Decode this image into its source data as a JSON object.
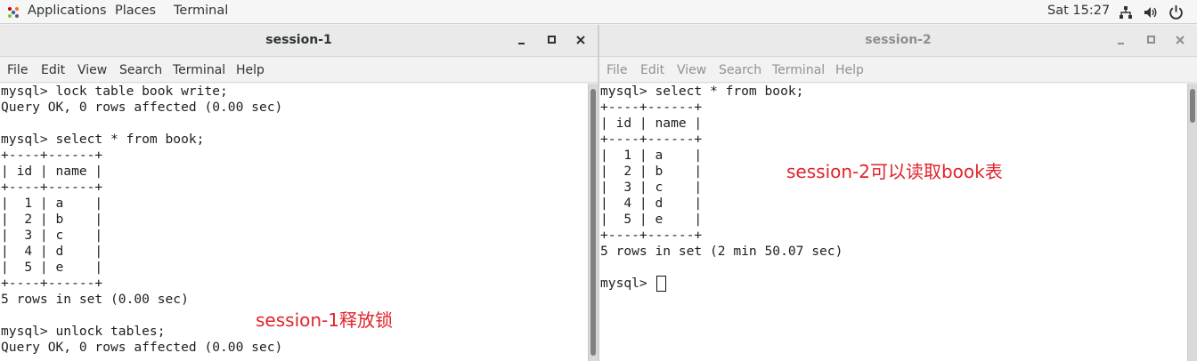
{
  "topbar": {
    "applications": "Applications",
    "places": "Places",
    "terminal": "Terminal",
    "clock": "Sat 15:27"
  },
  "session1": {
    "title": "session-1",
    "menu": [
      "File",
      "Edit",
      "View",
      "Search",
      "Terminal",
      "Help"
    ],
    "lines": [
      "mysql> lock table book write;",
      "Query OK, 0 rows affected (0.00 sec)",
      "",
      "mysql> select * from book;",
      "+----+------+",
      "| id | name |",
      "+----+------+",
      "|  1 | a    |",
      "|  2 | b    |",
      "|  3 | c    |",
      "|  4 | d    |",
      "|  5 | e    |",
      "+----+------+",
      "5 rows in set (0.00 sec)",
      "",
      "mysql> unlock tables;",
      "Query OK, 0 rows affected (0.00 sec)"
    ],
    "annotation": "session-1释放锁"
  },
  "session2": {
    "title": "session-2",
    "menu": [
      "File",
      "Edit",
      "View",
      "Search",
      "Terminal",
      "Help"
    ],
    "lines": [
      "mysql> select * from book;",
      "+----+------+",
      "| id | name |",
      "+----+------+",
      "|  1 | a    |",
      "|  2 | b    |",
      "|  3 | c    |",
      "|  4 | d    |",
      "|  5 | e    |",
      "+----+------+",
      "5 rows in set (2 min 50.07 sec)",
      "",
      "mysql> "
    ],
    "annotation": "session-2可以读取book表"
  },
  "colors": {
    "annotation": "#e0242b",
    "terminal_bg": "#ffffff",
    "terminal_fg": "#1e1e1e",
    "inactive_text": "#8d8f8f"
  }
}
